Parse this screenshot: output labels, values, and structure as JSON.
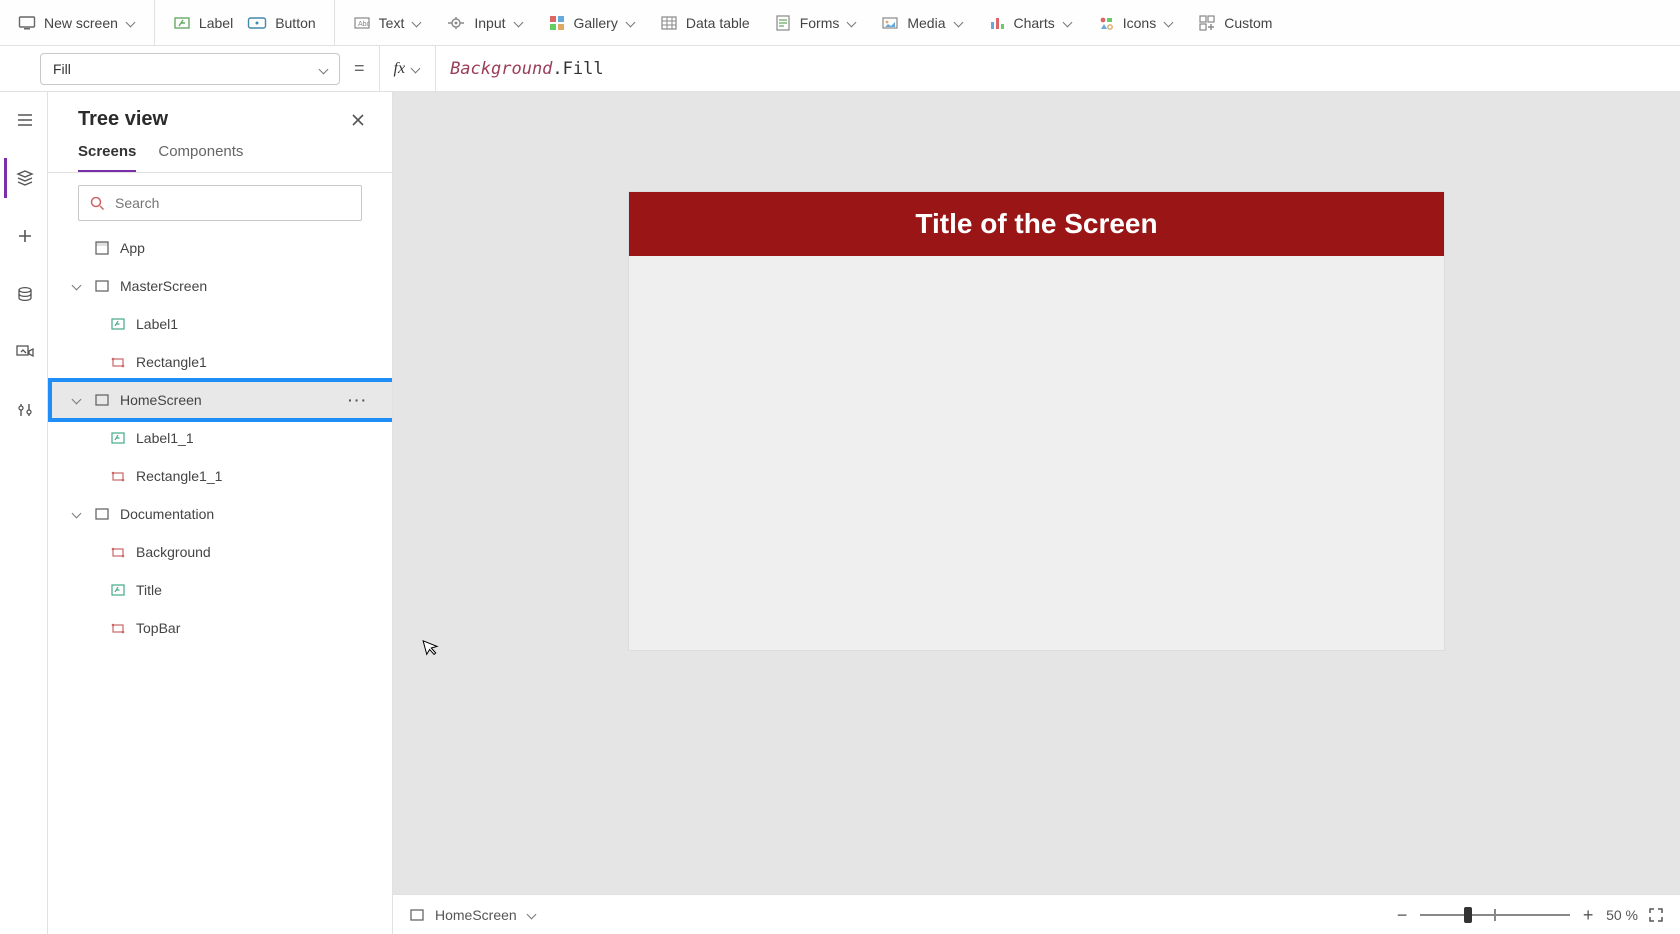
{
  "ribbon": {
    "new_screen": "New screen",
    "label": "Label",
    "button": "Button",
    "text": "Text",
    "input": "Input",
    "gallery": "Gallery",
    "data_table": "Data table",
    "forms": "Forms",
    "media": "Media",
    "charts": "Charts",
    "icons": "Icons",
    "custom": "Custom"
  },
  "formula": {
    "property": "Fill",
    "fx": "fx",
    "expr_italic": "Background",
    "expr_rest": ".Fill"
  },
  "tree": {
    "title": "Tree view",
    "tabs": {
      "screens": "Screens",
      "components": "Components"
    },
    "search_placeholder": "Search",
    "nodes": {
      "app": "App",
      "master": "MasterScreen",
      "label1": "Label1",
      "rect1": "Rectangle1",
      "home": "HomeScreen",
      "label1_1": "Label1_1",
      "rect1_1": "Rectangle1_1",
      "doc": "Documentation",
      "background": "Background",
      "title": "Title",
      "topbar": "TopBar"
    },
    "more": "···"
  },
  "canvas": {
    "title": "Title of the Screen"
  },
  "status": {
    "screen": "HomeScreen",
    "zoom_label": "50 %"
  },
  "colors": {
    "title_bar": "#9a1616",
    "highlight": "#1f8ef7"
  }
}
